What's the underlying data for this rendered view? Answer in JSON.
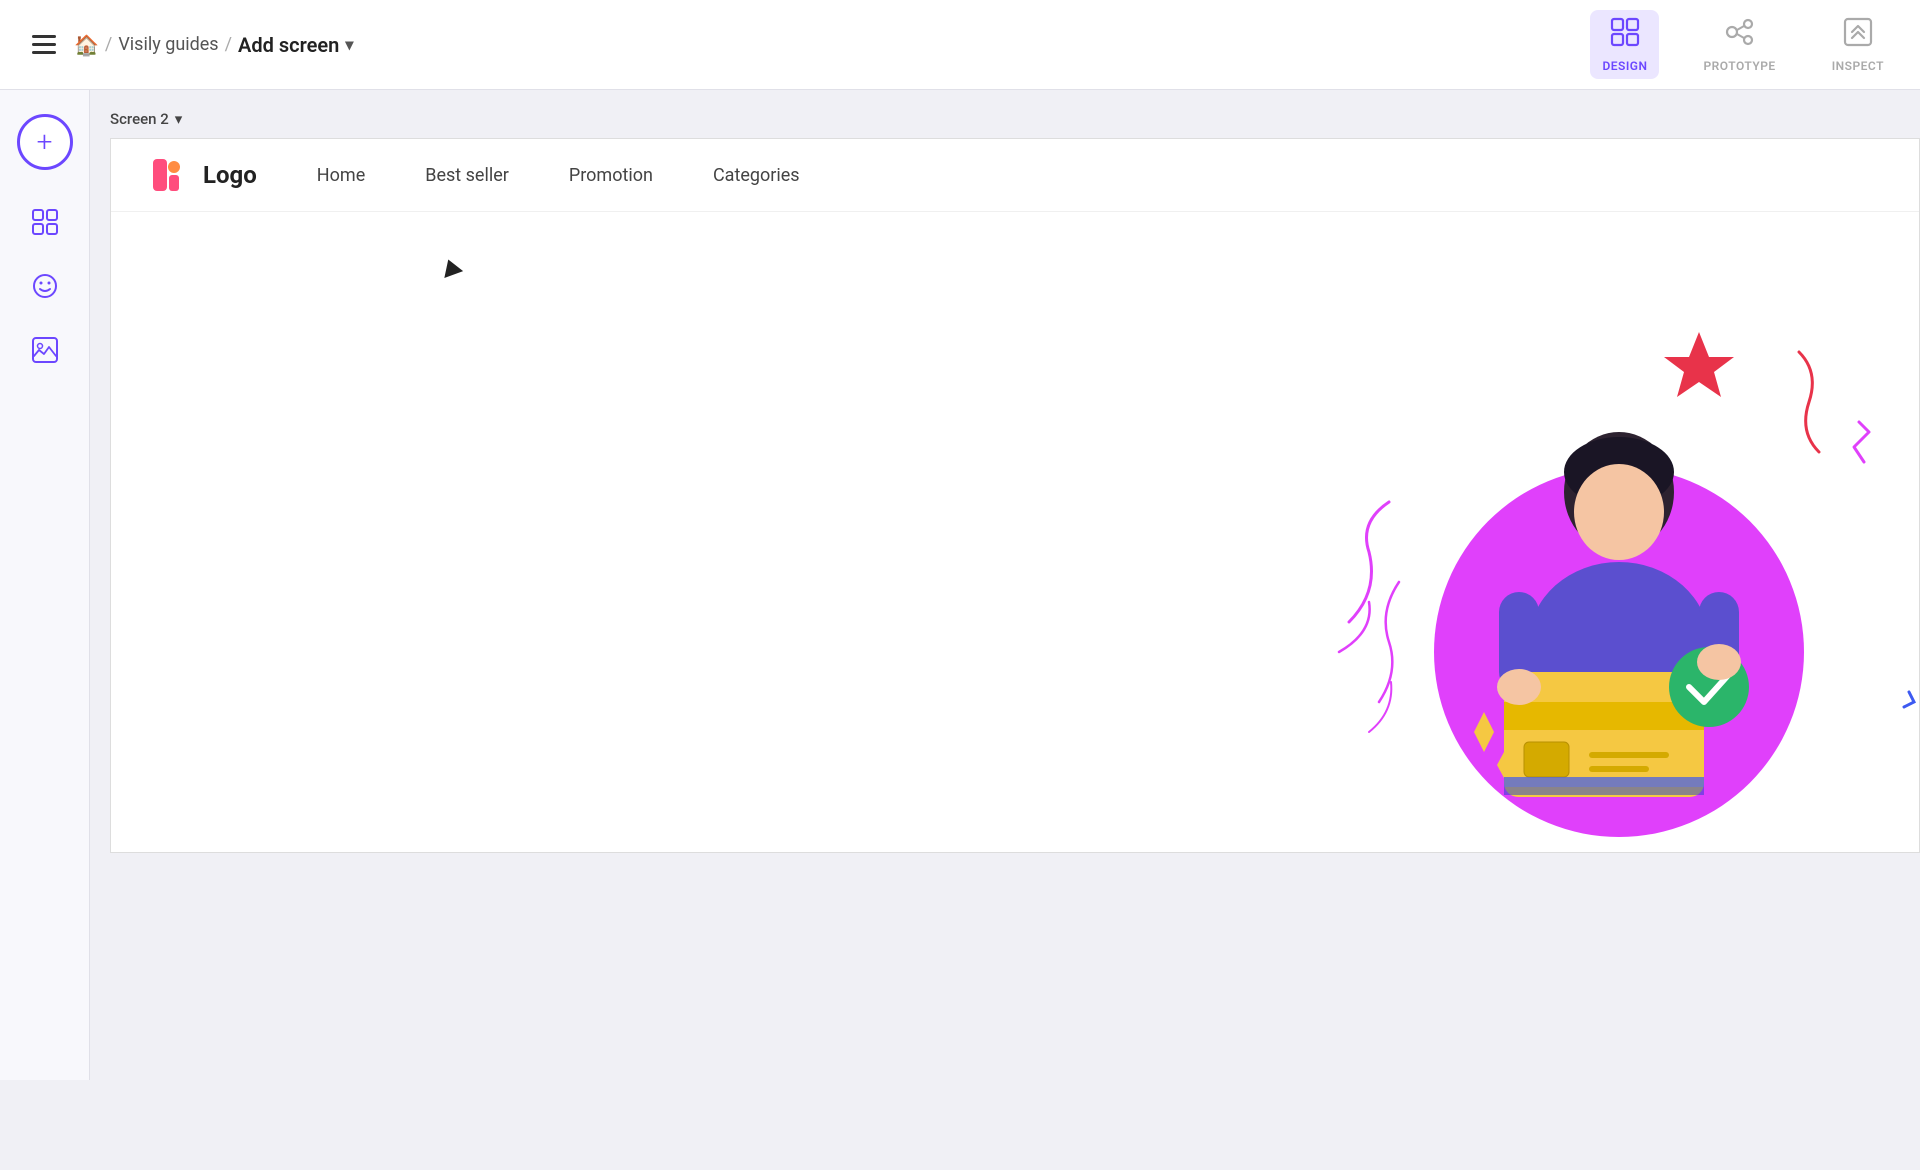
{
  "header": {
    "breadcrumb": {
      "home_label": "🏠",
      "separator": "/",
      "parent": "Visily guides",
      "current": "Add screen",
      "chevron": "▾"
    },
    "toolbar": [
      {
        "id": "design",
        "label": "DESIGN",
        "icon": "⊞",
        "active": true
      },
      {
        "id": "prototype",
        "label": "PROTOTYPE",
        "icon": "⟳",
        "active": false
      },
      {
        "id": "inspect",
        "label": "INSPECT",
        "icon": "</>",
        "active": false
      }
    ]
  },
  "sidebar": {
    "add_button_label": "+",
    "tools": [
      {
        "id": "components",
        "icon": "⊞",
        "label": "Components"
      },
      {
        "id": "emoji",
        "icon": "☺",
        "label": "Emoji"
      },
      {
        "id": "assets",
        "icon": "◫",
        "label": "Assets"
      }
    ]
  },
  "canvas": {
    "screen_label": "Screen 2",
    "navbar": {
      "logo_text": "Logo",
      "nav_links": [
        "Home",
        "Best seller",
        "Promotion",
        "Categories"
      ]
    }
  },
  "colors": {
    "accent_purple": "#6c47ff",
    "pink": "#ff4d7d",
    "orange": "#ff8c42",
    "yellow": "#f5c842",
    "red_star": "#e8334a",
    "green_check": "#2bb56a",
    "magenta": "#e040fb",
    "blue_accent": "#3d5af1"
  }
}
